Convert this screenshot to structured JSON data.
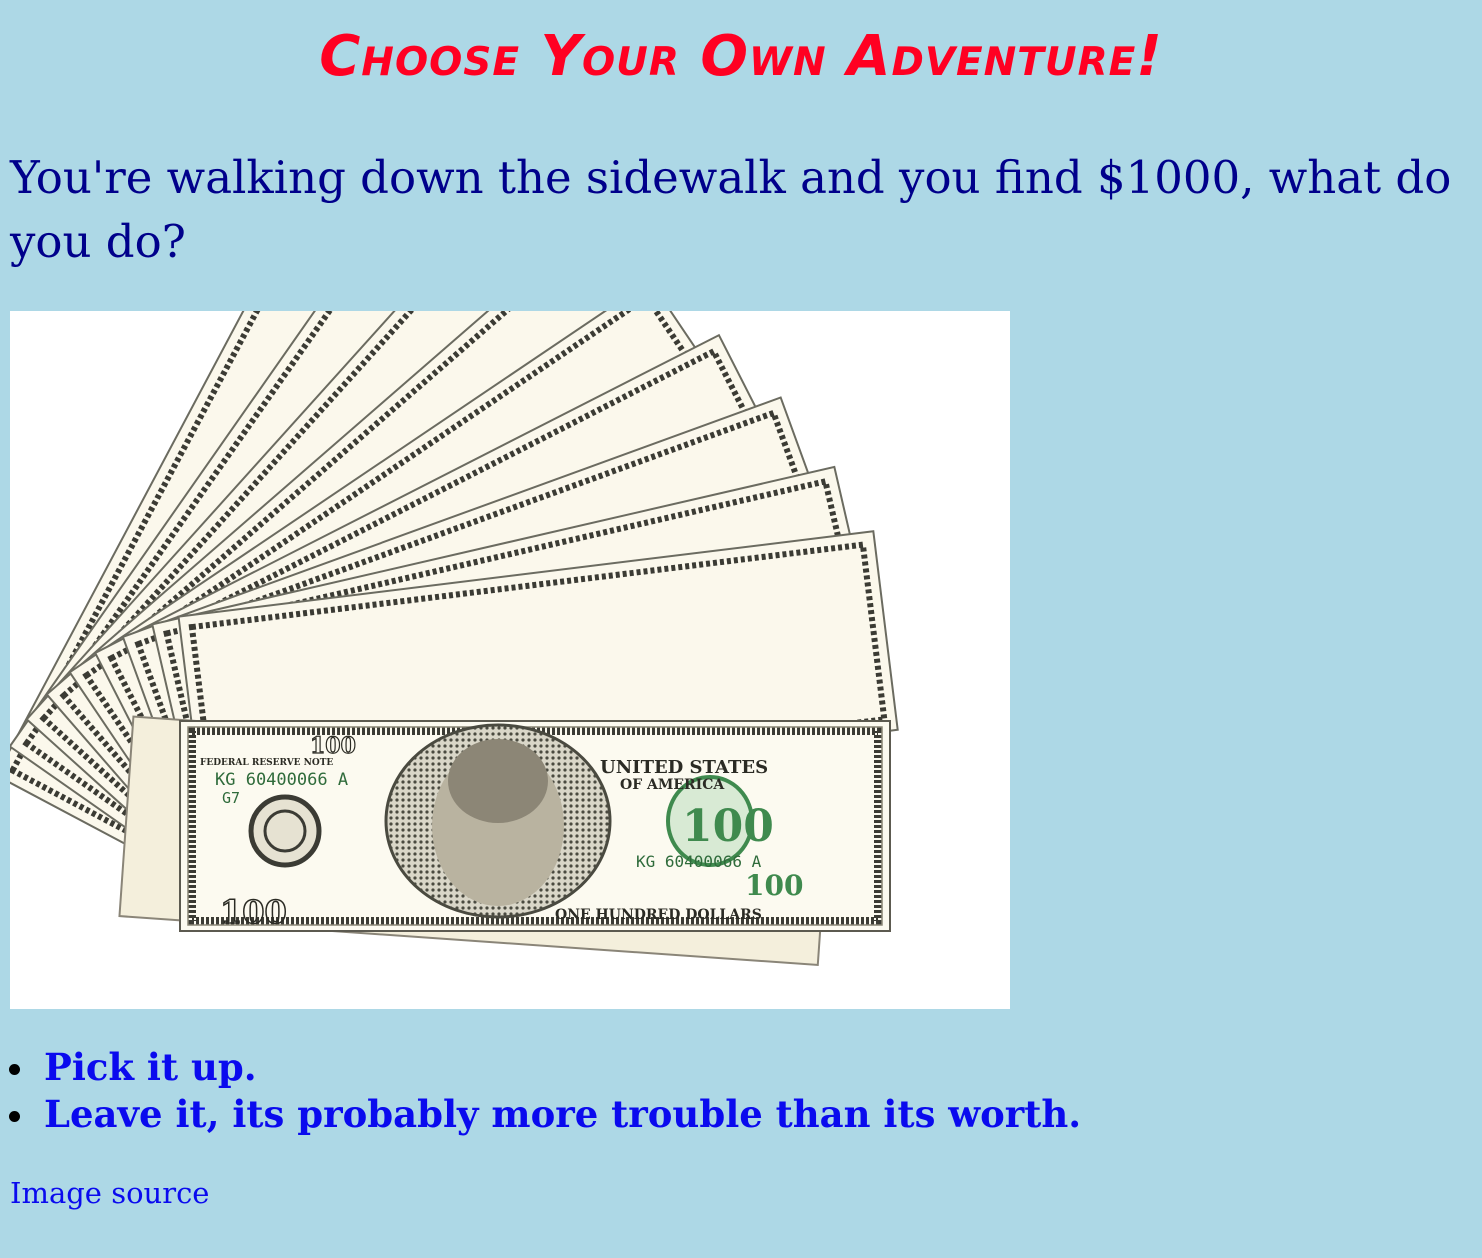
{
  "title": "Choose Your Own Adventure!",
  "question": "You're walking down the sidewalk and you find $1000, what do you do?",
  "image": {
    "subject": "fanned stack of hundred dollar bills",
    "bill_texts": {
      "serial": "KG 60400066 A",
      "district": "G7",
      "header": "FEDERAL RESERVE NOTE",
      "country_line1": "UNITED STATES",
      "country_line2": "OF AMERICA",
      "denomination": "100",
      "footer": "ONE HUNDRED DOLLARS"
    }
  },
  "choices": [
    {
      "label": "Pick it up."
    },
    {
      "label": "Leave it, its probably more trouble than its worth."
    }
  ],
  "image_source_label": "Image source",
  "colors": {
    "background": "#add8e6",
    "title": "#ff0022",
    "question": "#00008b",
    "link": "#0a0aee"
  }
}
